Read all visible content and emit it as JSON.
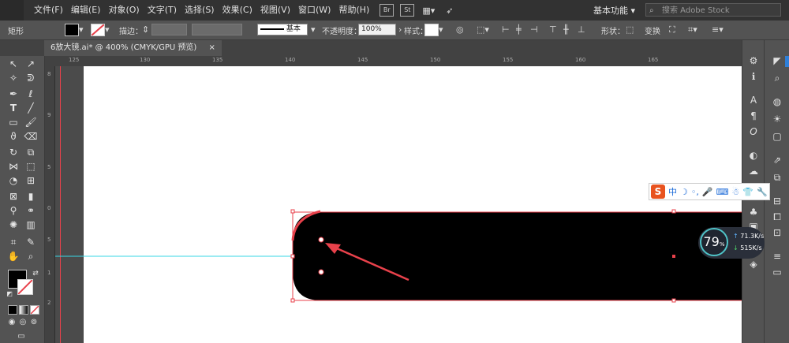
{
  "menu": {
    "items": [
      "文件(F)",
      "编辑(E)",
      "对象(O)",
      "文字(T)",
      "选择(S)",
      "效果(C)",
      "视图(V)",
      "窗口(W)",
      "帮助(H)"
    ],
    "bridge_label": "Br",
    "stock_label": "St",
    "workspace": "基本功能",
    "search_placeholder": "搜索 Adobe Stock"
  },
  "control_bar": {
    "object_type": "矩形",
    "stroke_label": "描边：",
    "stroke_style": "基本",
    "opacity_label": "不透明度：",
    "opacity_value": "100%",
    "style_label": "样式：",
    "shape_label": "形状：",
    "transform_label": "变换"
  },
  "document_tab": {
    "title": "6放大镜.ai* @ 400% (CMYK/GPU 预览)",
    "close": "×"
  },
  "ruler": {
    "h_ticks": [
      "125",
      "130",
      "135",
      "140",
      "145",
      "150",
      "155",
      "160",
      "165"
    ],
    "v_ticks": [
      "8",
      "9",
      "5",
      "0",
      "5",
      "1",
      "2"
    ]
  },
  "ime": {
    "logo": "S",
    "mode": "中"
  },
  "speed_widget": {
    "percent": "79",
    "percent_sign": "%",
    "upload": "71.3K/s",
    "download": "515K/s"
  },
  "colors": {
    "accent_red": "#e8414b",
    "guide_cyan": "#37d7e6",
    "ui_dark": "#323232",
    "ui_panel": "#535353"
  }
}
